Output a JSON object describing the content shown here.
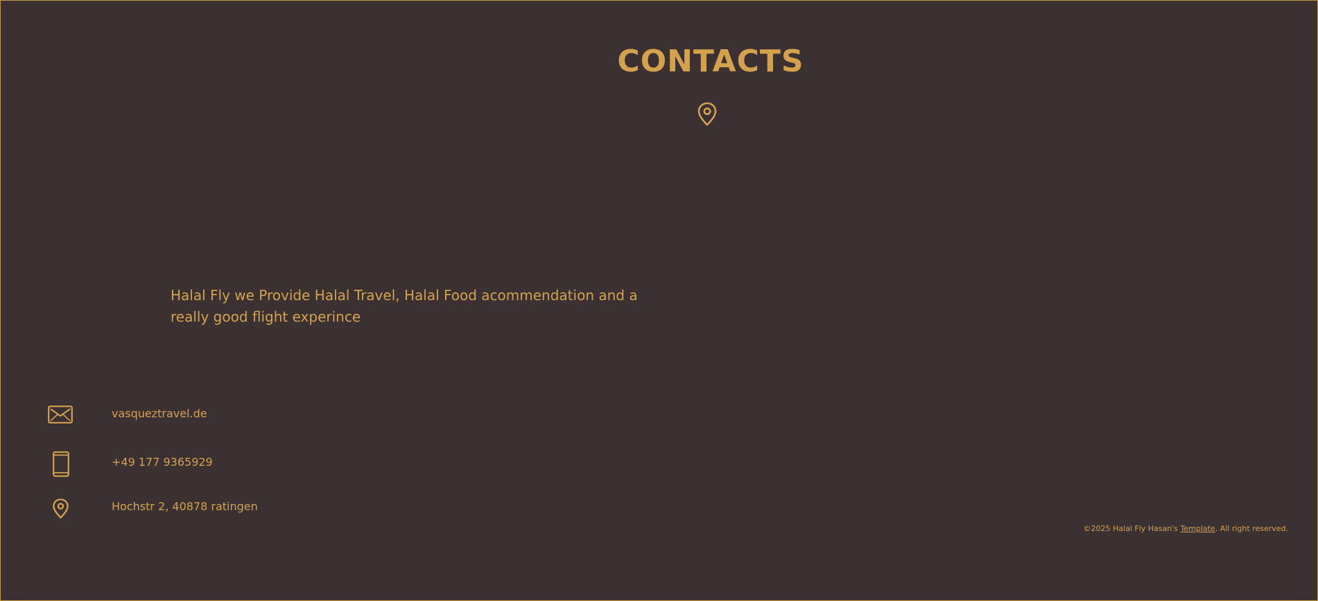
{
  "section": {
    "title": "CONTACTS",
    "description": "Halal Fly we Provide Halal Travel, Halal Food acommendation and a really good flight experince"
  },
  "contacts": {
    "email": "vasqueztravel.de",
    "phone": "+49 177 9365929",
    "address": "Hochstr 2, 40878 ratingen"
  },
  "footer": {
    "prefix": "©2025 Halal Fly Hasan's ",
    "link_label": "Template",
    "suffix": ". All right reserved."
  },
  "icons": {
    "top": "map-pin-icon",
    "email": "envelope-icon",
    "phone": "smartphone-icon",
    "address": "map-pin-icon"
  },
  "colors": {
    "background": "#3b3133",
    "accent": "#d4a24c"
  }
}
